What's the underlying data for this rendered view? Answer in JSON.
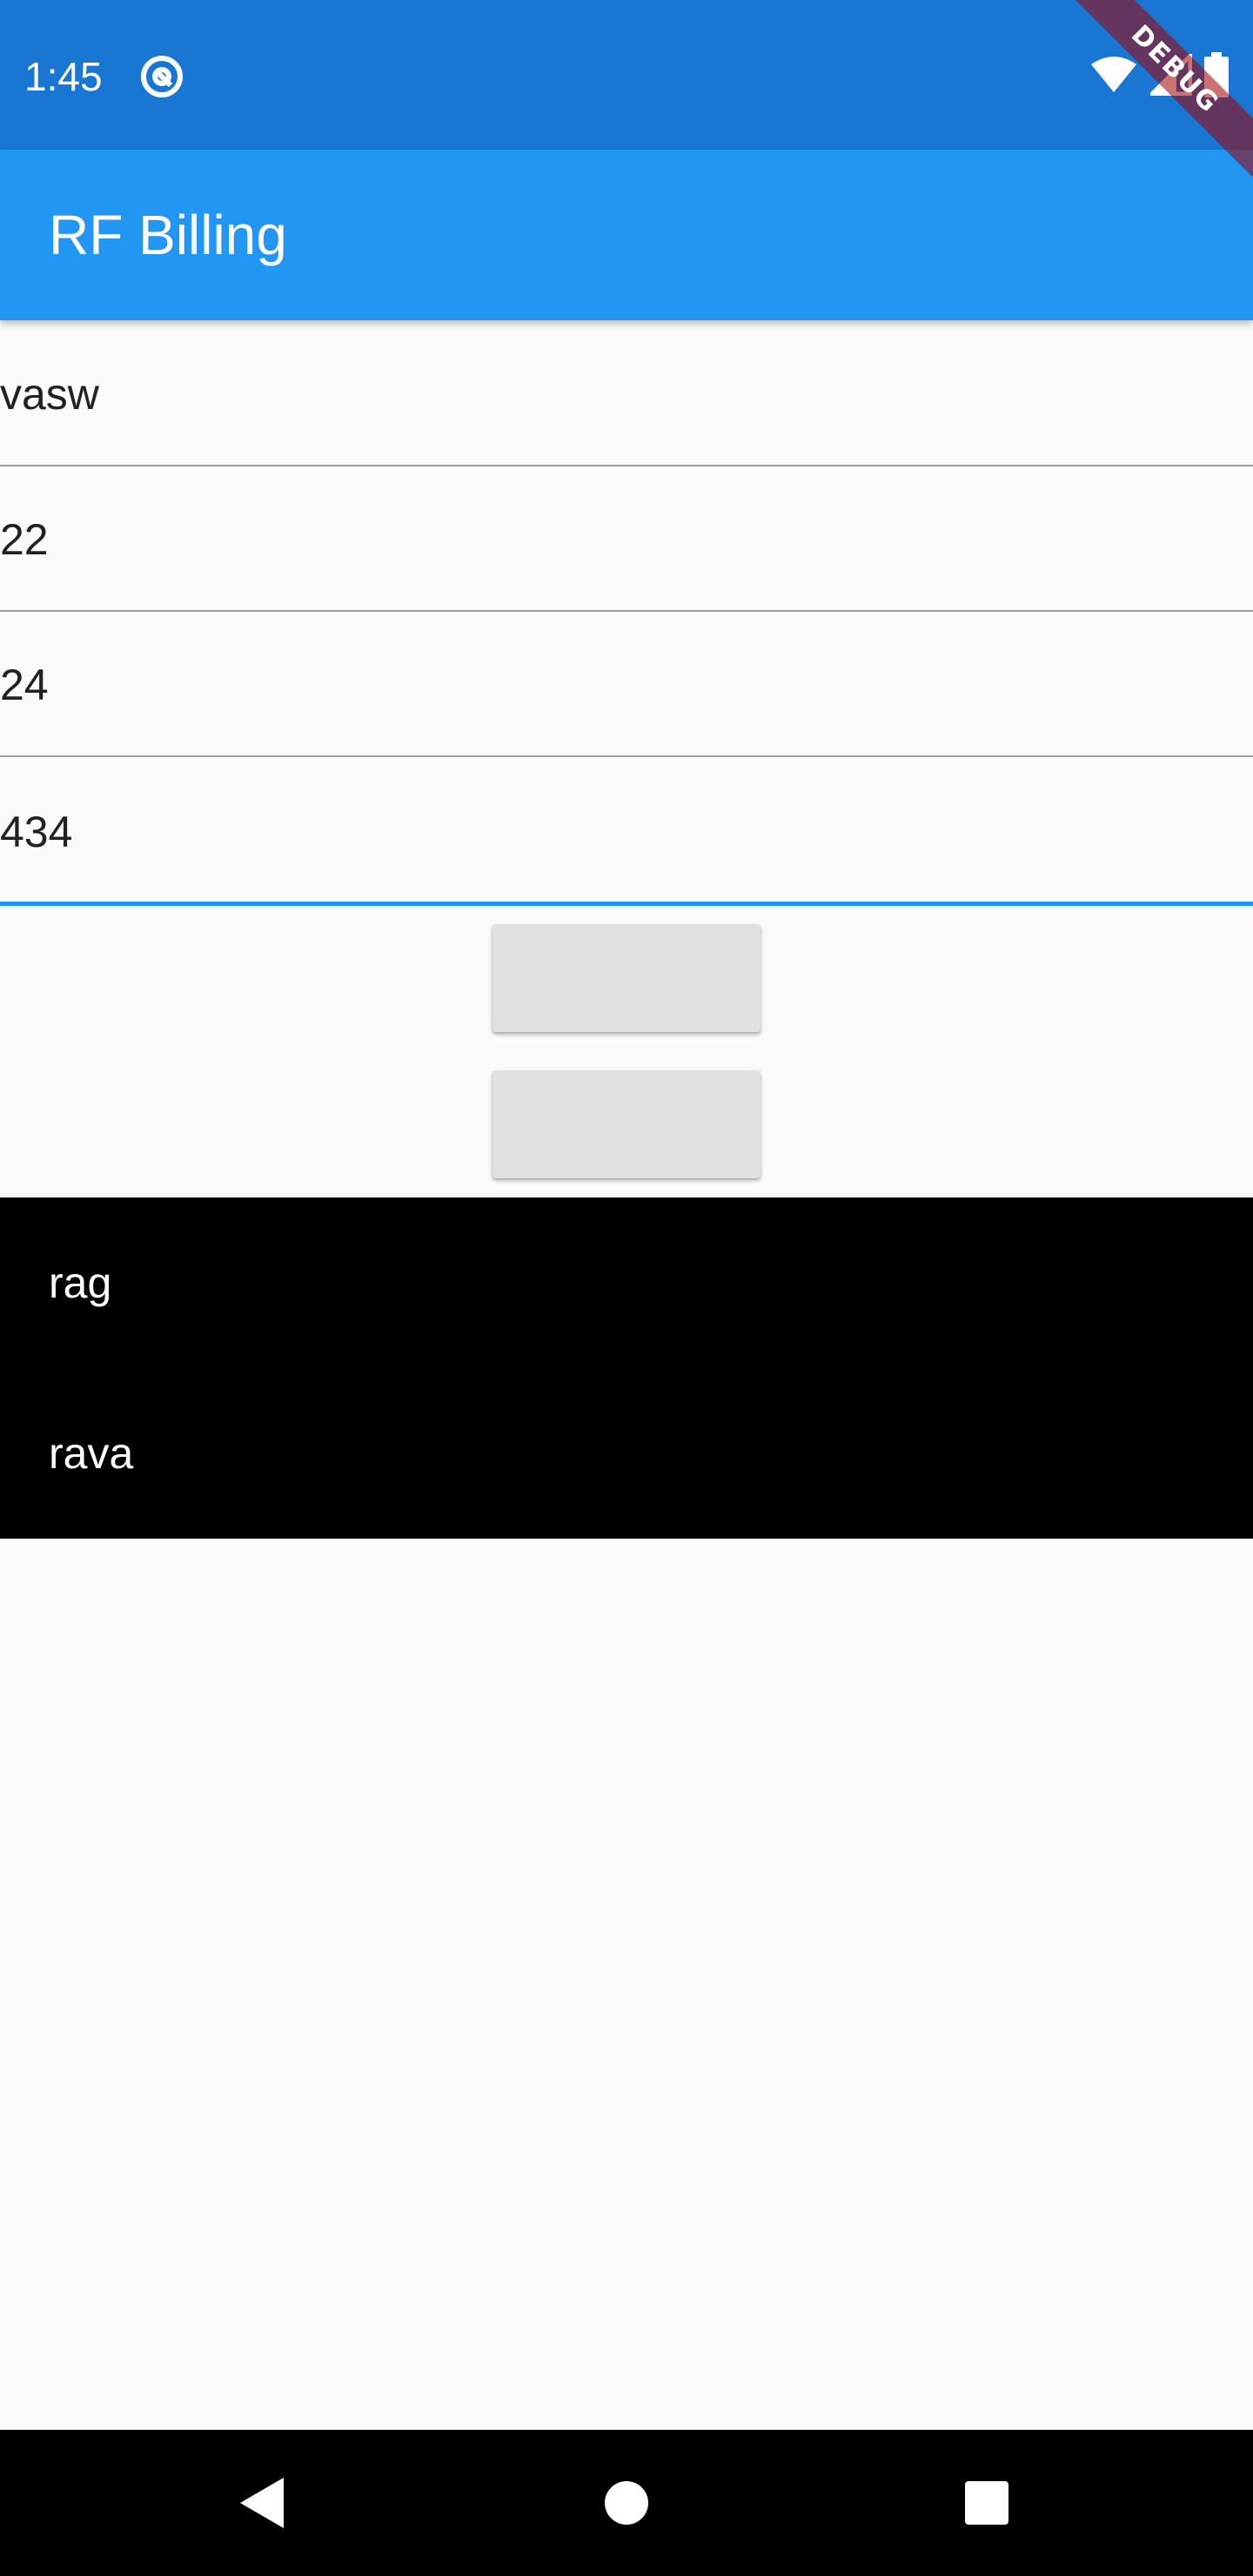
{
  "status_bar": {
    "time": "1:45",
    "app_icon": "at-sign-icon",
    "right_icons": [
      "wifi-icon",
      "signal-icon",
      "battery-icon"
    ],
    "debug_label": "DEBUG",
    "color": "#1976D2"
  },
  "app_bar": {
    "title": "RF Billing",
    "color": "#2196F3"
  },
  "form": {
    "fields": [
      {
        "value": "vasw"
      },
      {
        "value": "22"
      },
      {
        "value": "24"
      },
      {
        "value": "434"
      }
    ],
    "focus_color": "#2196F3"
  },
  "buttons": [
    {
      "label": ""
    },
    {
      "label": ""
    }
  ],
  "list": {
    "items": [
      {
        "label": "rag"
      },
      {
        "label": "rava"
      }
    ]
  },
  "nav_bar": {
    "buttons": [
      "back-icon",
      "home-icon",
      "recents-icon"
    ]
  }
}
